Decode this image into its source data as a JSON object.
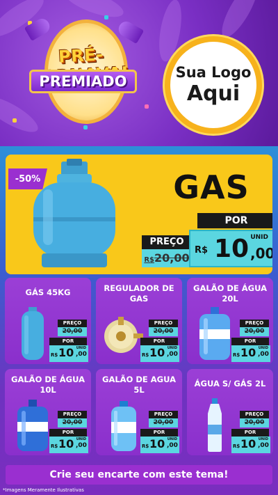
{
  "header": {
    "campaign_line1": "PRÉ-CARNAVAL",
    "campaign_line2": "PREMIADO",
    "logo_line1": "Sua Logo",
    "logo_line2": "Aqui"
  },
  "hero": {
    "discount": "-50%",
    "title": "GAS",
    "preco_label": "PREÇO",
    "old_price_prefix": "R$",
    "old_price": "20,00",
    "por_label": "POR",
    "unit": "UNID",
    "currency": "R$",
    "price_int": "10",
    "price_dec": ",00"
  },
  "products": [
    {
      "title": "GÁS 45KG",
      "preco_label": "PREÇO",
      "old_price": "20,00",
      "por_label": "POR",
      "unit": "UNID",
      "currency": "R$",
      "price_int": "10",
      "price_dec": ",00"
    },
    {
      "title": "REGULADOR DE GAS",
      "preco_label": "PREÇO",
      "old_price": "20,00",
      "por_label": "POR",
      "unit": "UNID",
      "currency": "R$",
      "price_int": "10",
      "price_dec": ",00"
    },
    {
      "title": "GALÃO DE ÁGUA 20L",
      "preco_label": "PREÇO",
      "old_price": "20,00",
      "por_label": "POR",
      "unit": "UNID",
      "currency": "R$",
      "price_int": "10",
      "price_dec": ",00"
    },
    {
      "title": "GALÃO DE ÁGUA 10L",
      "preco_label": "PREÇO",
      "old_price": "20,00",
      "por_label": "POR",
      "unit": "UNID",
      "currency": "R$",
      "price_int": "10",
      "price_dec": ",00"
    },
    {
      "title": "GALÃO DE AGUA 5L",
      "preco_label": "PREÇO",
      "old_price": "20,00",
      "por_label": "POR",
      "unit": "UNID",
      "currency": "R$",
      "price_int": "10",
      "price_dec": ",00"
    },
    {
      "title": "ÁGUA S/ GÁS 2L",
      "preco_label": "PREÇO",
      "old_price": "20,00",
      "por_label": "POR",
      "unit": "UNID",
      "currency": "R$",
      "price_int": "10",
      "price_dec": ",00"
    }
  ],
  "footer": {
    "cta": "Crie seu encarte com este tema!",
    "disclaimer": "*Imagens Meramente Ilustrativas"
  },
  "colors": {
    "purple": "#9a2fd0",
    "yellow": "#f9c81a",
    "cyan": "#5bd6e0",
    "black": "#1a1a1a"
  }
}
